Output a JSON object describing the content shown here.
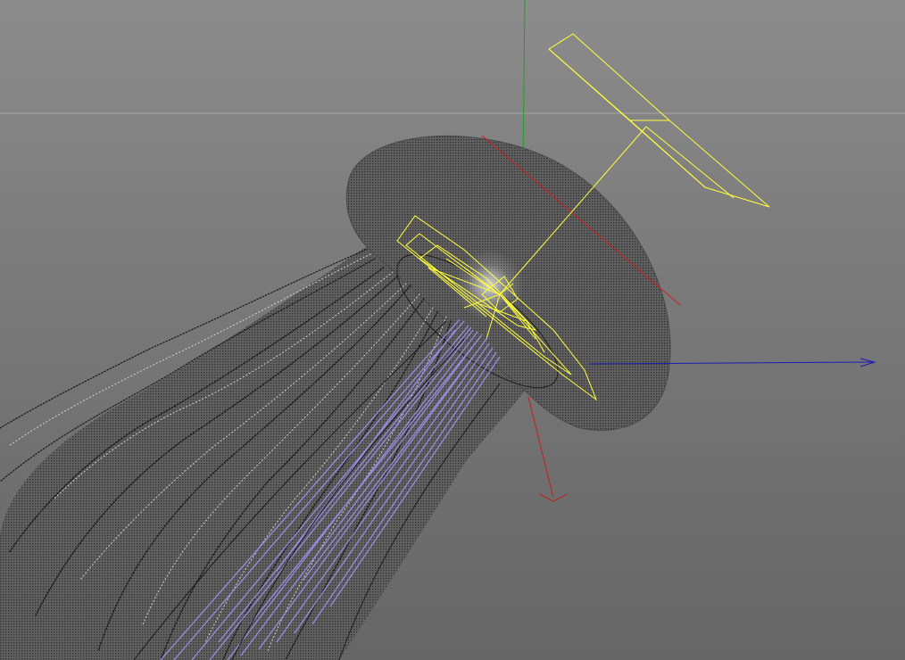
{
  "viewport": {
    "background_top": "#8c8c8c",
    "background_bottom": "#666666",
    "horizon_color": "#a8a8a8"
  },
  "colors": {
    "mesh_fill": "#5f5f5f",
    "mesh_dots": "#2a2a2a",
    "mesh_outline": "#1e1e1e",
    "strand_dots": "#1a1a1a",
    "strand_highlight": "#d8d8d8",
    "particles": "#9a8fe8",
    "camera_wire": "#ffff3c",
    "axis_x": "#cc2020",
    "axis_y": "#20a020",
    "axis_z": "#1a1ab0",
    "gizmo": "#c02020"
  },
  "objects": {
    "jellyfish": "jellyfish-mesh",
    "camera": "camera-object",
    "light": "light-object"
  },
  "icons": {
    "axis_arrow": "arrow-head-icon"
  }
}
